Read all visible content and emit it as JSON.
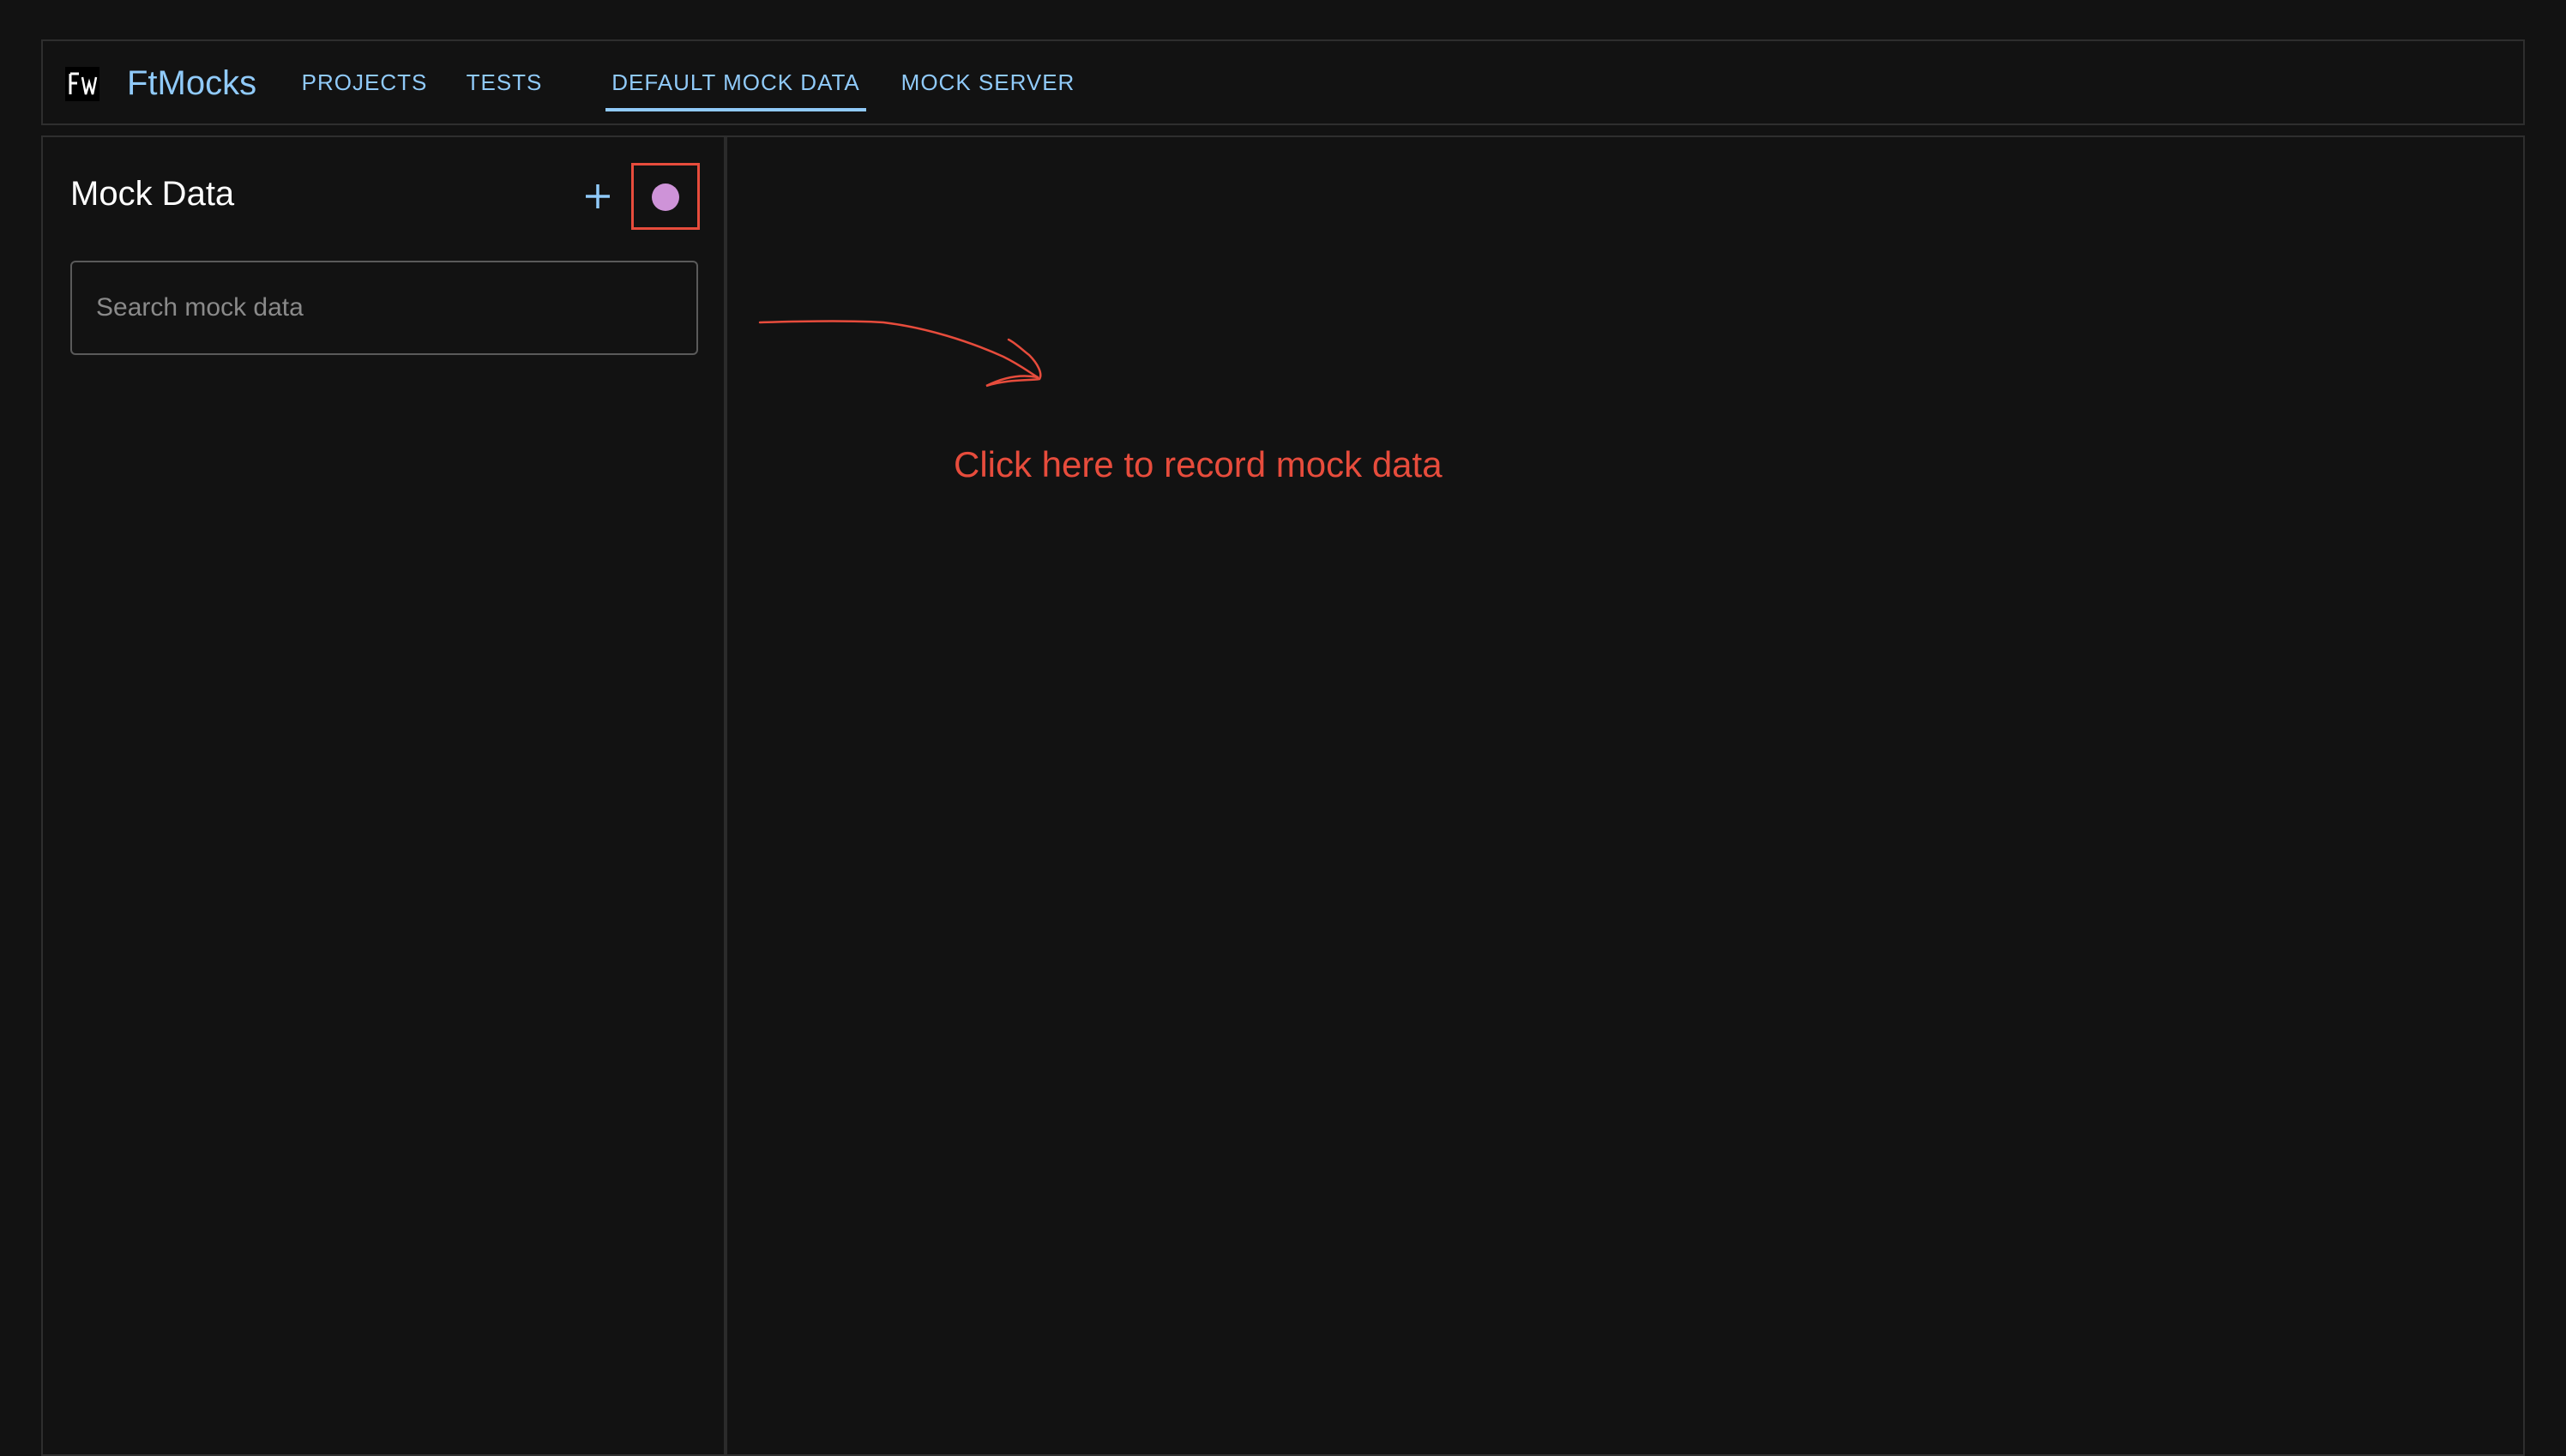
{
  "header": {
    "logo_icon": "ftmocks-logo-icon",
    "brand": "FtMocks",
    "tabs": [
      {
        "label": "PROJECTS",
        "active": false
      },
      {
        "label": "TESTS",
        "active": false
      },
      {
        "label": "DEFAULT MOCK DATA",
        "active": true
      },
      {
        "label": "MOCK SERVER",
        "active": false
      }
    ]
  },
  "sidebar": {
    "title": "Mock Data",
    "add_icon": "plus-icon",
    "record_icon": "record-icon",
    "search": {
      "placeholder": "Search mock data",
      "value": ""
    }
  },
  "annotation": {
    "text": "Click here to record mock data",
    "color": "#e74c3c"
  },
  "colors": {
    "background": "#121212",
    "accent": "#90caf9",
    "record": "#ce93d8",
    "annotation": "#e74c3c"
  }
}
